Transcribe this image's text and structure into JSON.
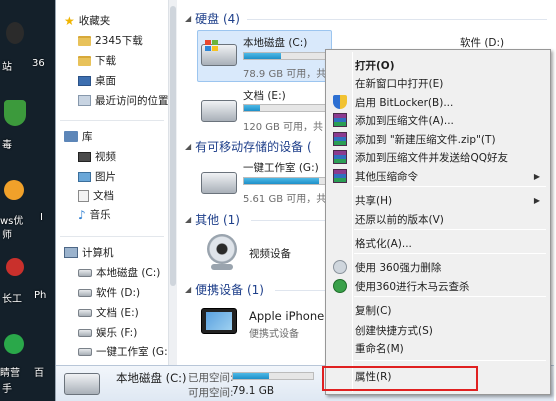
{
  "desktop": {
    "labels": [
      "站",
      "36",
      "毒",
      "ws优",
      "师",
      "I",
      "长工",
      "Ph",
      "睛营",
      "手",
      "百"
    ]
  },
  "nav": {
    "favorites": "收藏夹",
    "fav_items": [
      "2345下载",
      "下载",
      "桌面",
      "最近访问的位置"
    ],
    "library": "库",
    "lib_items": [
      "视频",
      "图片",
      "文档",
      "音乐"
    ],
    "computer": "计算机",
    "comp_items": [
      "本地磁盘 (C:)",
      "软件 (D:)",
      "文档 (E:)",
      "娱乐 (F:)",
      "一键工作室 (G:)"
    ]
  },
  "main": {
    "hdd_group": "硬盘 (4)",
    "removable_group": "有可移动存储的设备 (",
    "other_group": "其他 (1)",
    "portable_group": "便携设备 (1)",
    "drives": [
      {
        "name": "本地磁盘 (C:)",
        "info": "78.9 GB 可用，共",
        "used": 0.45
      },
      {
        "name": "软件 (D:)",
        "info": "",
        "used": 0.0
      },
      {
        "name": "文档 (E:)",
        "info": "120 GB 可用，共",
        "used": 0.2
      },
      {
        "name": "一键工作室 (G:)",
        "info": "5.61 GB 可用，共",
        "used": 0.92
      }
    ],
    "other_item": "视频设备",
    "portable_item": "Apple iPhone",
    "portable_sub": "便携式设备"
  },
  "status": {
    "name": "本地磁盘 (C:)",
    "used_label": "已用空间:",
    "free_label": "可用空间:",
    "free_value": "79.1 GB",
    "used_fraction": 0.45
  },
  "menu": {
    "items": [
      {
        "label": "打开(O)",
        "bold": true,
        "icon": ""
      },
      {
        "label": "在新窗口中打开(E)",
        "icon": ""
      },
      {
        "label": "启用 BitLocker(B)...",
        "icon": "shield-icon"
      },
      {
        "label": "添加到压缩文件(A)...",
        "icon": "winrar-icon"
      },
      {
        "label": "添加到 \"新建压缩文件.zip\"(T)",
        "icon": "winrar-icon"
      },
      {
        "label": "添加到压缩文件并发送给QQ好友",
        "icon": "winrar-icon"
      },
      {
        "label": "其他压缩命令",
        "icon": "winrar-icon",
        "submenu": true
      },
      {
        "label": "共享(H)",
        "submenu": true,
        "icon": ""
      },
      {
        "label": "还原以前的版本(V)",
        "icon": ""
      },
      {
        "label": "格式化(A)...",
        "icon": ""
      },
      {
        "label": "使用 360强力删除",
        "icon": "360-delete-icon"
      },
      {
        "label": "使用360进行木马云查杀",
        "icon": "360-scan-icon"
      },
      {
        "label": "复制(C)",
        "icon": ""
      },
      {
        "label": "创建快捷方式(S)",
        "icon": ""
      },
      {
        "label": "重命名(M)",
        "icon": ""
      },
      {
        "label": "属性(R)",
        "icon": ""
      }
    ],
    "submenu_arrow": "▶"
  },
  "colors": {
    "highlight_border": "#e02020",
    "group_header": "#1e3f8a",
    "bar_fill": "#1d8fc9"
  }
}
